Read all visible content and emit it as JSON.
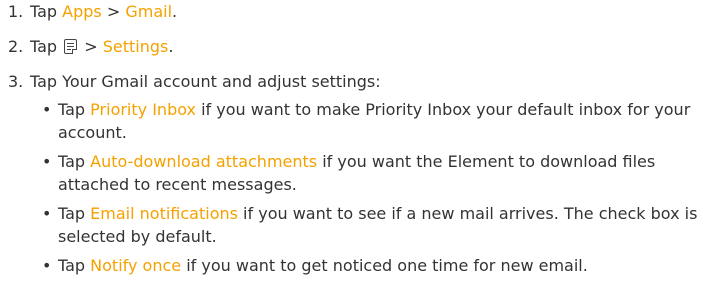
{
  "steps": [
    {
      "num": "1.",
      "t1": "Tap ",
      "h1": "Apps",
      "sep": " > ",
      "h2": "Gmail",
      "end": "."
    },
    {
      "num": "2.",
      "t1": "Tap ",
      "icon": "menu-icon",
      "sep": " > ",
      "h1": "Settings",
      "end": "."
    },
    {
      "num": "3.",
      "text": "Tap Your Gmail account and adjust settings:"
    }
  ],
  "bullets": [
    {
      "dot": "•",
      "pre": "Tap ",
      "hl": "Priority Inbox",
      "post": " if you want to make Priority Inbox your default inbox for your account."
    },
    {
      "dot": "•",
      "pre": "Tap ",
      "hl": "Auto-download attachments",
      "post": " if you want the Element to download files attached to recent messages."
    },
    {
      "dot": "•",
      "pre": "Tap ",
      "hl": "Email notifications",
      "post": " if you want to see if a new mail arrives. The check box is selected by default."
    },
    {
      "dot": "•",
      "pre": "Tap ",
      "hl": "Notify once",
      "post": " if you want to get noticed one time for new email."
    }
  ],
  "colors": {
    "highlight": "#f5a100",
    "text": "#333333"
  }
}
